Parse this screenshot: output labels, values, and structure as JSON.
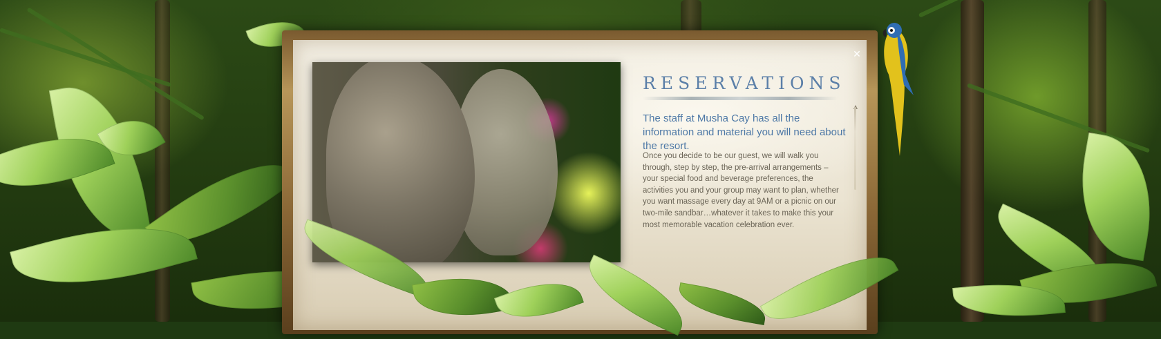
{
  "dialog": {
    "title": "RESERVATIONS",
    "lead": "The staff at Musha Cay has all the information and material you will need about the resort.",
    "body": "Once you decide to be our guest, we will walk you through, step by step, the pre-arrival arrangements – your special food and beverage preferences, the activities you and your group may want to plan, whether you want massage every day at 9AM or a picnic on our two-mile sandbar…whatever it takes to make this your most memorable vacation celebration ever.",
    "close_label": "✕"
  },
  "colors": {
    "title": "#5b7fa8",
    "lead": "#4d78a6",
    "body": "#6b6557",
    "panel": "#f3efe4"
  }
}
